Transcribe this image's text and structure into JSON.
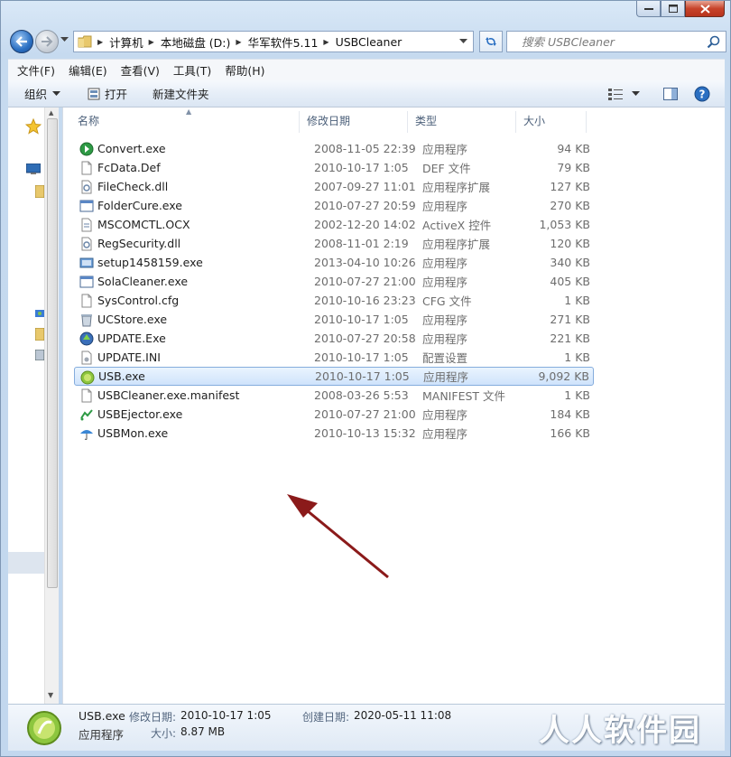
{
  "window": {
    "minimize_glyph": "—",
    "close_glyph": "✕"
  },
  "address": {
    "crumbs": [
      "计算机",
      "本地磁盘 (D:)",
      "华军软件5.11",
      "USBCleaner"
    ]
  },
  "search": {
    "placeholder": "搜索 USBCleaner"
  },
  "menu": [
    "文件(F)",
    "编辑(E)",
    "查看(V)",
    "工具(T)",
    "帮助(H)"
  ],
  "toolbar": {
    "organize": "组织",
    "open": "打开",
    "new_folder": "新建文件夹"
  },
  "columns": {
    "name": "名称",
    "date": "修改日期",
    "type": "类型",
    "size": "大小"
  },
  "files": [
    {
      "name": "Convert.exe",
      "date": "2008-11-05 22:39",
      "type": "应用程序",
      "size": "94 KB",
      "icon": "convert-icon"
    },
    {
      "name": "FcData.Def",
      "date": "2010-10-17 1:05",
      "type": "DEF 文件",
      "size": "79 KB",
      "icon": "file-icon"
    },
    {
      "name": "FileCheck.dll",
      "date": "2007-09-27 11:01",
      "type": "应用程序扩展",
      "size": "127 KB",
      "icon": "dll-icon"
    },
    {
      "name": "FolderCure.exe",
      "date": "2010-07-27 20:59",
      "type": "应用程序",
      "size": "270 KB",
      "icon": "app-window-icon"
    },
    {
      "name": "MSCOMCTL.OCX",
      "date": "2002-12-20 14:02",
      "type": "ActiveX 控件",
      "size": "1,053 KB",
      "icon": "ocx-icon"
    },
    {
      "name": "RegSecurity.dll",
      "date": "2008-11-01 2:19",
      "type": "应用程序扩展",
      "size": "120 KB",
      "icon": "dll-icon"
    },
    {
      "name": "setup1458159.exe",
      "date": "2013-04-10 10:26",
      "type": "应用程序",
      "size": "340 KB",
      "icon": "setup-icon"
    },
    {
      "name": "SolaCleaner.exe",
      "date": "2010-07-27 21:00",
      "type": "应用程序",
      "size": "405 KB",
      "icon": "app-window-icon"
    },
    {
      "name": "SysControl.cfg",
      "date": "2010-10-16 23:23",
      "type": "CFG 文件",
      "size": "1 KB",
      "icon": "file-icon"
    },
    {
      "name": "UCStore.exe",
      "date": "2010-10-17 1:05",
      "type": "应用程序",
      "size": "271 KB",
      "icon": "recycle-bin-icon"
    },
    {
      "name": "UPDATE.Exe",
      "date": "2010-07-27 20:58",
      "type": "应用程序",
      "size": "221 KB",
      "icon": "update-icon"
    },
    {
      "name": "UPDATE.INI",
      "date": "2010-10-17 1:05",
      "type": "配置设置",
      "size": "1 KB",
      "icon": "ini-icon"
    },
    {
      "name": "USB.exe",
      "date": "2010-10-17 1:05",
      "type": "应用程序",
      "size": "9,092 KB",
      "icon": "usb-app-icon",
      "selected": true
    },
    {
      "name": "USBCleaner.exe.manifest",
      "date": "2008-03-26 5:53",
      "type": "MANIFEST 文件",
      "size": "1 KB",
      "icon": "file-icon"
    },
    {
      "name": "USBEjector.exe",
      "date": "2010-07-27 21:00",
      "type": "应用程序",
      "size": "184 KB",
      "icon": "ejector-icon"
    },
    {
      "name": "USBMon.exe",
      "date": "2010-10-13 15:32",
      "type": "应用程序",
      "size": "166 KB",
      "icon": "umbrella-icon"
    }
  ],
  "details": {
    "name": "USB.exe",
    "type": "应用程序",
    "modified_label": "修改日期:",
    "modified_value": "2010-10-17 1:05",
    "size_label": "大小:",
    "size_value": "8.87 MB",
    "created_label": "创建日期:",
    "created_value": "2020-05-11 11:08"
  },
  "watermark": "人人软件园",
  "colors": {
    "selection": "#cfe3fb",
    "arrow": "#8b1a1a"
  }
}
